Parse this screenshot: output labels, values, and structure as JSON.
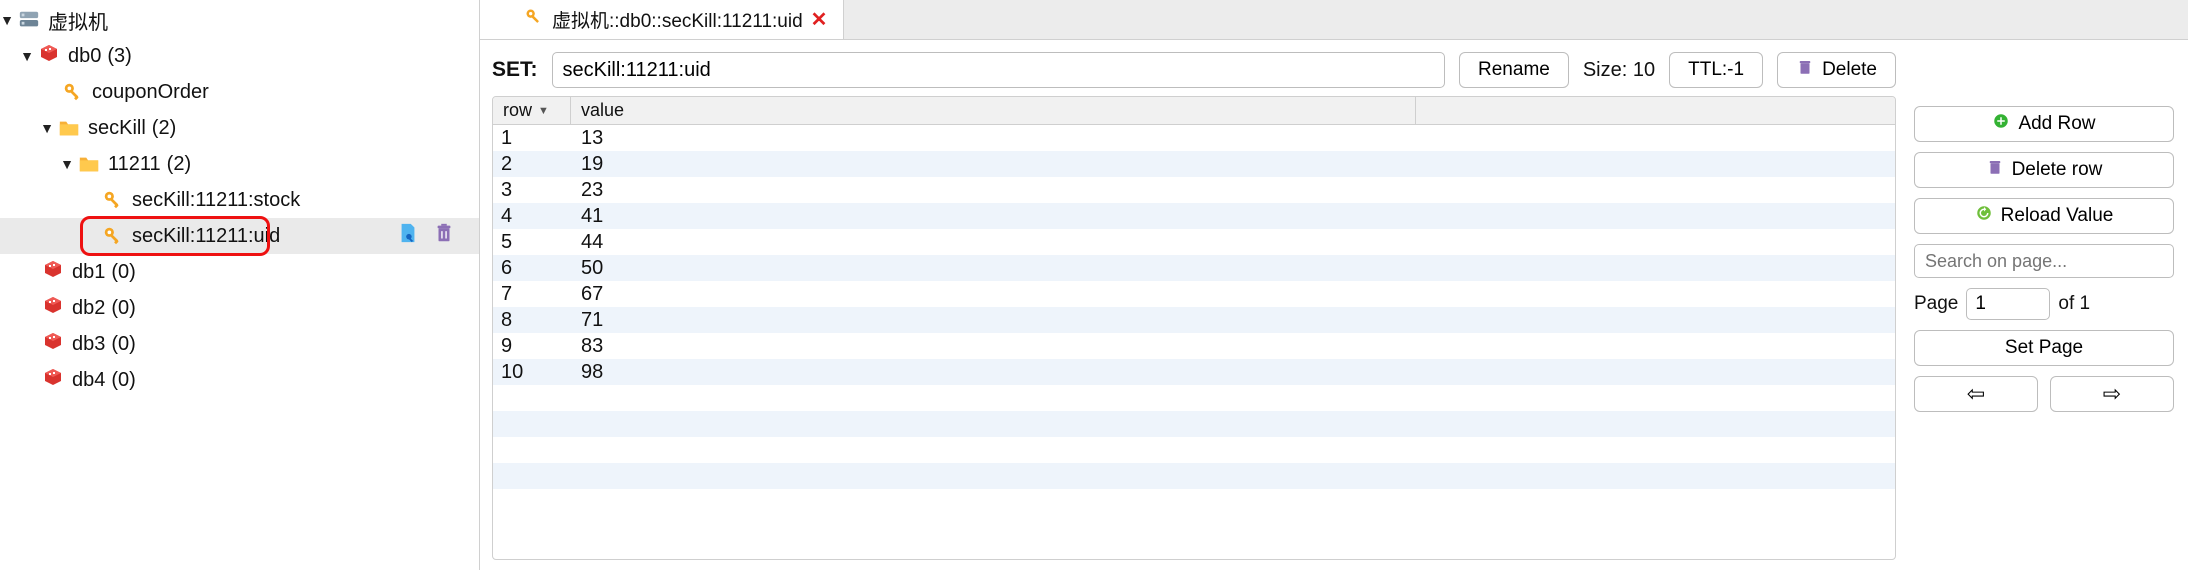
{
  "tree": {
    "root": {
      "label": "虚拟机"
    },
    "db0": {
      "label": "db0",
      "count": "(3)"
    },
    "couponOrder": {
      "label": "couponOrder"
    },
    "secKill": {
      "label": "secKill",
      "count": "(2)"
    },
    "g11211": {
      "label": "11211",
      "count": "(2)"
    },
    "stock": {
      "label": "secKill:11211:stock"
    },
    "uid": {
      "label": "secKill:11211:uid"
    },
    "db1": {
      "label": "db1",
      "count": "(0)"
    },
    "db2": {
      "label": "db2",
      "count": "(0)"
    },
    "db3": {
      "label": "db3",
      "count": "(0)"
    },
    "db4": {
      "label": "db4",
      "count": "(0)"
    }
  },
  "tab": {
    "title": "虚拟机::db0::secKill:11211:uid"
  },
  "key": {
    "type_label": "SET:",
    "name": "secKill:11211:uid",
    "rename": "Rename",
    "size_label": "Size:",
    "size_value": "10",
    "ttl": "TTL:-1",
    "delete": "Delete"
  },
  "table": {
    "header_row": "row",
    "header_value": "value",
    "rows": [
      {
        "row": "1",
        "value": "13"
      },
      {
        "row": "2",
        "value": "19"
      },
      {
        "row": "3",
        "value": "23"
      },
      {
        "row": "4",
        "value": "41"
      },
      {
        "row": "5",
        "value": "44"
      },
      {
        "row": "6",
        "value": "50"
      },
      {
        "row": "7",
        "value": "67"
      },
      {
        "row": "8",
        "value": "71"
      },
      {
        "row": "9",
        "value": "83"
      },
      {
        "row": "10",
        "value": "98"
      }
    ]
  },
  "side": {
    "add_row": "Add Row",
    "delete_row": "Delete row",
    "reload": "Reload Value",
    "search_placeholder": "Search on page...",
    "page_label": "Page",
    "page_value": "1",
    "page_of": "of 1",
    "set_page": "Set Page"
  },
  "icons": {
    "server": "server-icon",
    "db": "database-icon",
    "key": "key-icon",
    "folder": "folder-icon",
    "trash": "trash-icon",
    "file_key": "file-key-icon",
    "plus": "plus-icon",
    "reload": "reload-icon"
  }
}
